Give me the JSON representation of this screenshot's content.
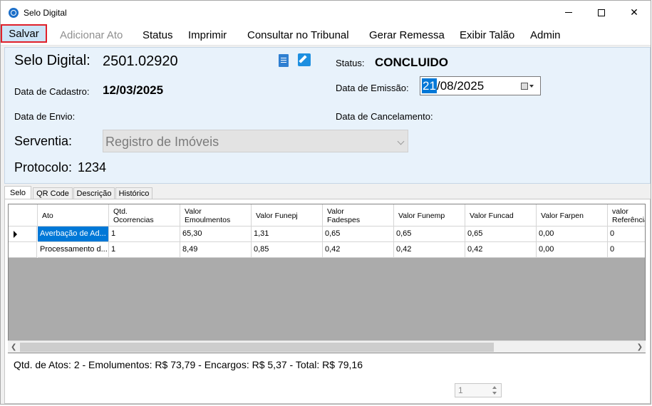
{
  "window": {
    "title": "Selo Digital"
  },
  "menu": [
    {
      "label": "Salvar",
      "enabled": true
    },
    {
      "label": "Adicionar Ato",
      "enabled": false
    },
    {
      "label": "Status",
      "enabled": true
    },
    {
      "label": "Imprimir",
      "enabled": true
    },
    {
      "label": "Consultar no Tribunal",
      "enabled": true
    },
    {
      "label": "Gerar Remessa",
      "enabled": true
    },
    {
      "label": "Exibir Talão",
      "enabled": true
    },
    {
      "label": "Admin",
      "enabled": true
    }
  ],
  "header": {
    "selo_label": "Selo Digital:",
    "selo_value": "2501.02920",
    "status_label": "Status:",
    "status_value": "CONCLUIDO",
    "cadastro_label": "Data de Cadastro:",
    "cadastro_value": "12/03/2025",
    "emissao_label": "Data de Emissão:",
    "emissao_day": "21",
    "emissao_rest": "/08/2025",
    "envio_label": "Data de Envio:",
    "cancelamento_label": "Data de Cancelamento:",
    "serventia_label": "Serventia:",
    "serventia_value": "Registro de Imóveis",
    "protocolo_label": "Protocolo:",
    "protocolo_value": "1234"
  },
  "tabs": [
    "Selo",
    "QR Code",
    "Descrição",
    "Histórico"
  ],
  "grid": {
    "columns": [
      "Ato",
      "Qtd.\nOcorrencias",
      "Valor\nEmoulmentos",
      "Valor Funepj",
      "Valor\nFadespes",
      "Valor Funemp",
      "Valor Funcad",
      "Valor Farpen",
      "valor\nReferência"
    ],
    "rows": [
      [
        "Averbação de Ad...",
        "1",
        "65,30",
        "1,31",
        "0,65",
        "0,65",
        "0,65",
        "0,00",
        "0"
      ],
      [
        "Processamento d...",
        "1",
        "8,49",
        "0,85",
        "0,42",
        "0,42",
        "0,42",
        "0,00",
        "0"
      ]
    ]
  },
  "totals": "Qtd. de Atos: 2  -   Emolumentos: R$ 73,79   -   Encargos: R$ 5,37   -   Total: R$ 79,16",
  "spinner": {
    "value": "1"
  },
  "colors": {
    "accent": "#0078d7",
    "highlight_border": "#e0202a",
    "panel": "#e8f2fb"
  }
}
